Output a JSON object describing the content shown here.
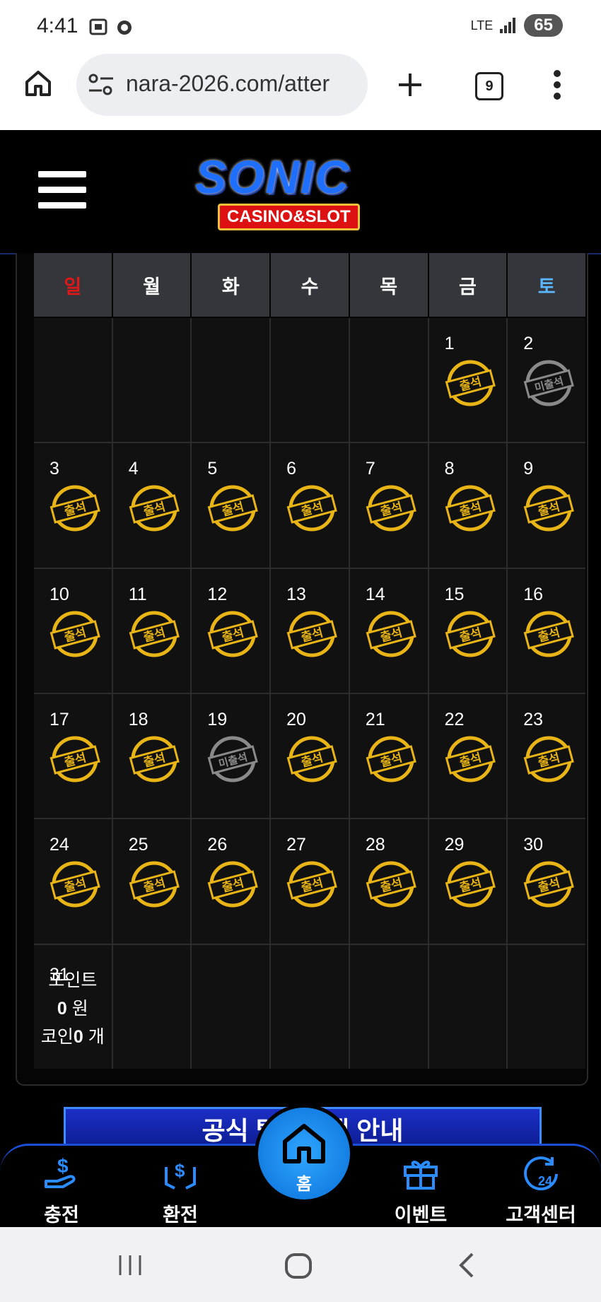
{
  "status_bar": {
    "time": "4:41",
    "network": "LTE",
    "battery": "65"
  },
  "browser": {
    "url": "nara-2026.com/atter",
    "tab_count": "9"
  },
  "header": {
    "logo_main": "SONIC",
    "logo_sub": "CASINO&SLOT"
  },
  "calendar": {
    "weekdays": [
      "일",
      "월",
      "화",
      "수",
      "목",
      "금",
      "토"
    ],
    "weekday_colors": [
      "#e01818",
      "#ffffff",
      "#ffffff",
      "#ffffff",
      "#ffffff",
      "#ffffff",
      "#5bb8ff"
    ],
    "days": [
      {
        "day": "",
        "status": ""
      },
      {
        "day": "",
        "status": ""
      },
      {
        "day": "",
        "status": ""
      },
      {
        "day": "",
        "status": ""
      },
      {
        "day": "",
        "status": ""
      },
      {
        "day": "1",
        "status": "출석"
      },
      {
        "day": "2",
        "status": "미출석"
      },
      {
        "day": "3",
        "status": "출석"
      },
      {
        "day": "4",
        "status": "출석"
      },
      {
        "day": "5",
        "status": "출석"
      },
      {
        "day": "6",
        "status": "출석"
      },
      {
        "day": "7",
        "status": "출석"
      },
      {
        "day": "8",
        "status": "출석"
      },
      {
        "day": "9",
        "status": "출석"
      },
      {
        "day": "10",
        "status": "출석"
      },
      {
        "day": "11",
        "status": "출석"
      },
      {
        "day": "12",
        "status": "출석"
      },
      {
        "day": "13",
        "status": "출석"
      },
      {
        "day": "14",
        "status": "출석"
      },
      {
        "day": "15",
        "status": "출석"
      },
      {
        "day": "16",
        "status": "출석"
      },
      {
        "day": "17",
        "status": "출석"
      },
      {
        "day": "18",
        "status": "출석"
      },
      {
        "day": "19",
        "status": "미출석"
      },
      {
        "day": "20",
        "status": "출석"
      },
      {
        "day": "21",
        "status": "출석"
      },
      {
        "day": "22",
        "status": "출석"
      },
      {
        "day": "23",
        "status": "출석"
      },
      {
        "day": "24",
        "status": "출석"
      },
      {
        "day": "25",
        "status": "출석"
      },
      {
        "day": "26",
        "status": "출석"
      },
      {
        "day": "27",
        "status": "출석"
      },
      {
        "day": "28",
        "status": "출석"
      },
      {
        "day": "29",
        "status": "출석"
      },
      {
        "day": "30",
        "status": "출석"
      },
      {
        "day": "31",
        "status": ""
      },
      {
        "day": "",
        "status": ""
      },
      {
        "day": "",
        "status": ""
      },
      {
        "day": "",
        "status": ""
      },
      {
        "day": "",
        "status": ""
      },
      {
        "day": "",
        "status": ""
      },
      {
        "day": "",
        "status": ""
      }
    ],
    "colors": {
      "attended": "#e8b416",
      "absent": "#8a8a8a"
    }
  },
  "points_summary": {
    "points_label": "포인트",
    "points_value": "0",
    "points_unit": "원",
    "coins_label": "코인",
    "coins_value": "0",
    "coins_unit": "개"
  },
  "banner": {
    "text": "공식 텔레그램 안내"
  },
  "bottom_nav": {
    "deposit": "충전",
    "withdraw": "환전",
    "home": "홈",
    "event": "이벤트",
    "support": "고객센터"
  }
}
